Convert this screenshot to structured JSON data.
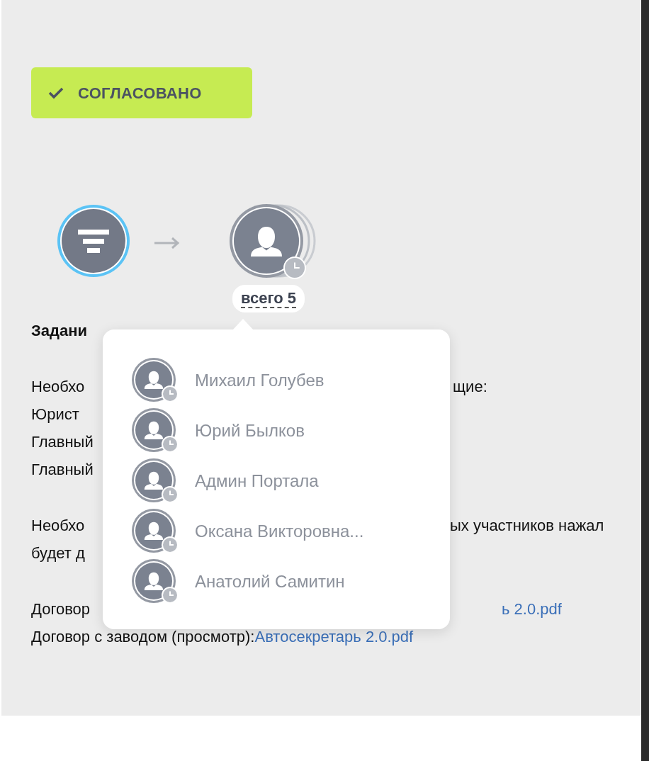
{
  "status": {
    "label": "СОГЛАСОВАНО"
  },
  "route": {
    "steps": [
      {
        "kind": "filter",
        "active": true,
        "pending": false
      },
      {
        "kind": "participants",
        "active": false,
        "pending": true
      }
    ],
    "total_label": "всего 5"
  },
  "task": {
    "lines": [
      {
        "kind": "heading",
        "left": "Задани"
      },
      {
        "kind": "gap"
      },
      {
        "kind": "text",
        "left": "Необхо",
        "right": "щие:"
      },
      {
        "kind": "text",
        "left": "Юрист"
      },
      {
        "kind": "text",
        "left": "Главный"
      },
      {
        "kind": "text",
        "left": "Главный"
      },
      {
        "kind": "gap"
      },
      {
        "kind": "text",
        "left": "Необхо",
        "right": "ых участников нажал"
      },
      {
        "kind": "text",
        "left": "будет д"
      },
      {
        "kind": "gap"
      },
      {
        "kind": "text",
        "left": "Договор",
        "link": "ь 2.0.pdf"
      },
      {
        "kind": "text",
        "left": "Договор с заводом (просмотр): ",
        "link": "Автосекретарь 2.0.pdf"
      }
    ]
  },
  "popup": {
    "participants": [
      {
        "name": "Михаил Голубев",
        "pending": true
      },
      {
        "name": "Юрий Былков",
        "pending": true
      },
      {
        "name": "Админ Портала",
        "pending": true
      },
      {
        "name": "Оксана Викторовна...",
        "pending": true
      },
      {
        "name": "Анатолий Самитин",
        "pending": true
      }
    ]
  }
}
